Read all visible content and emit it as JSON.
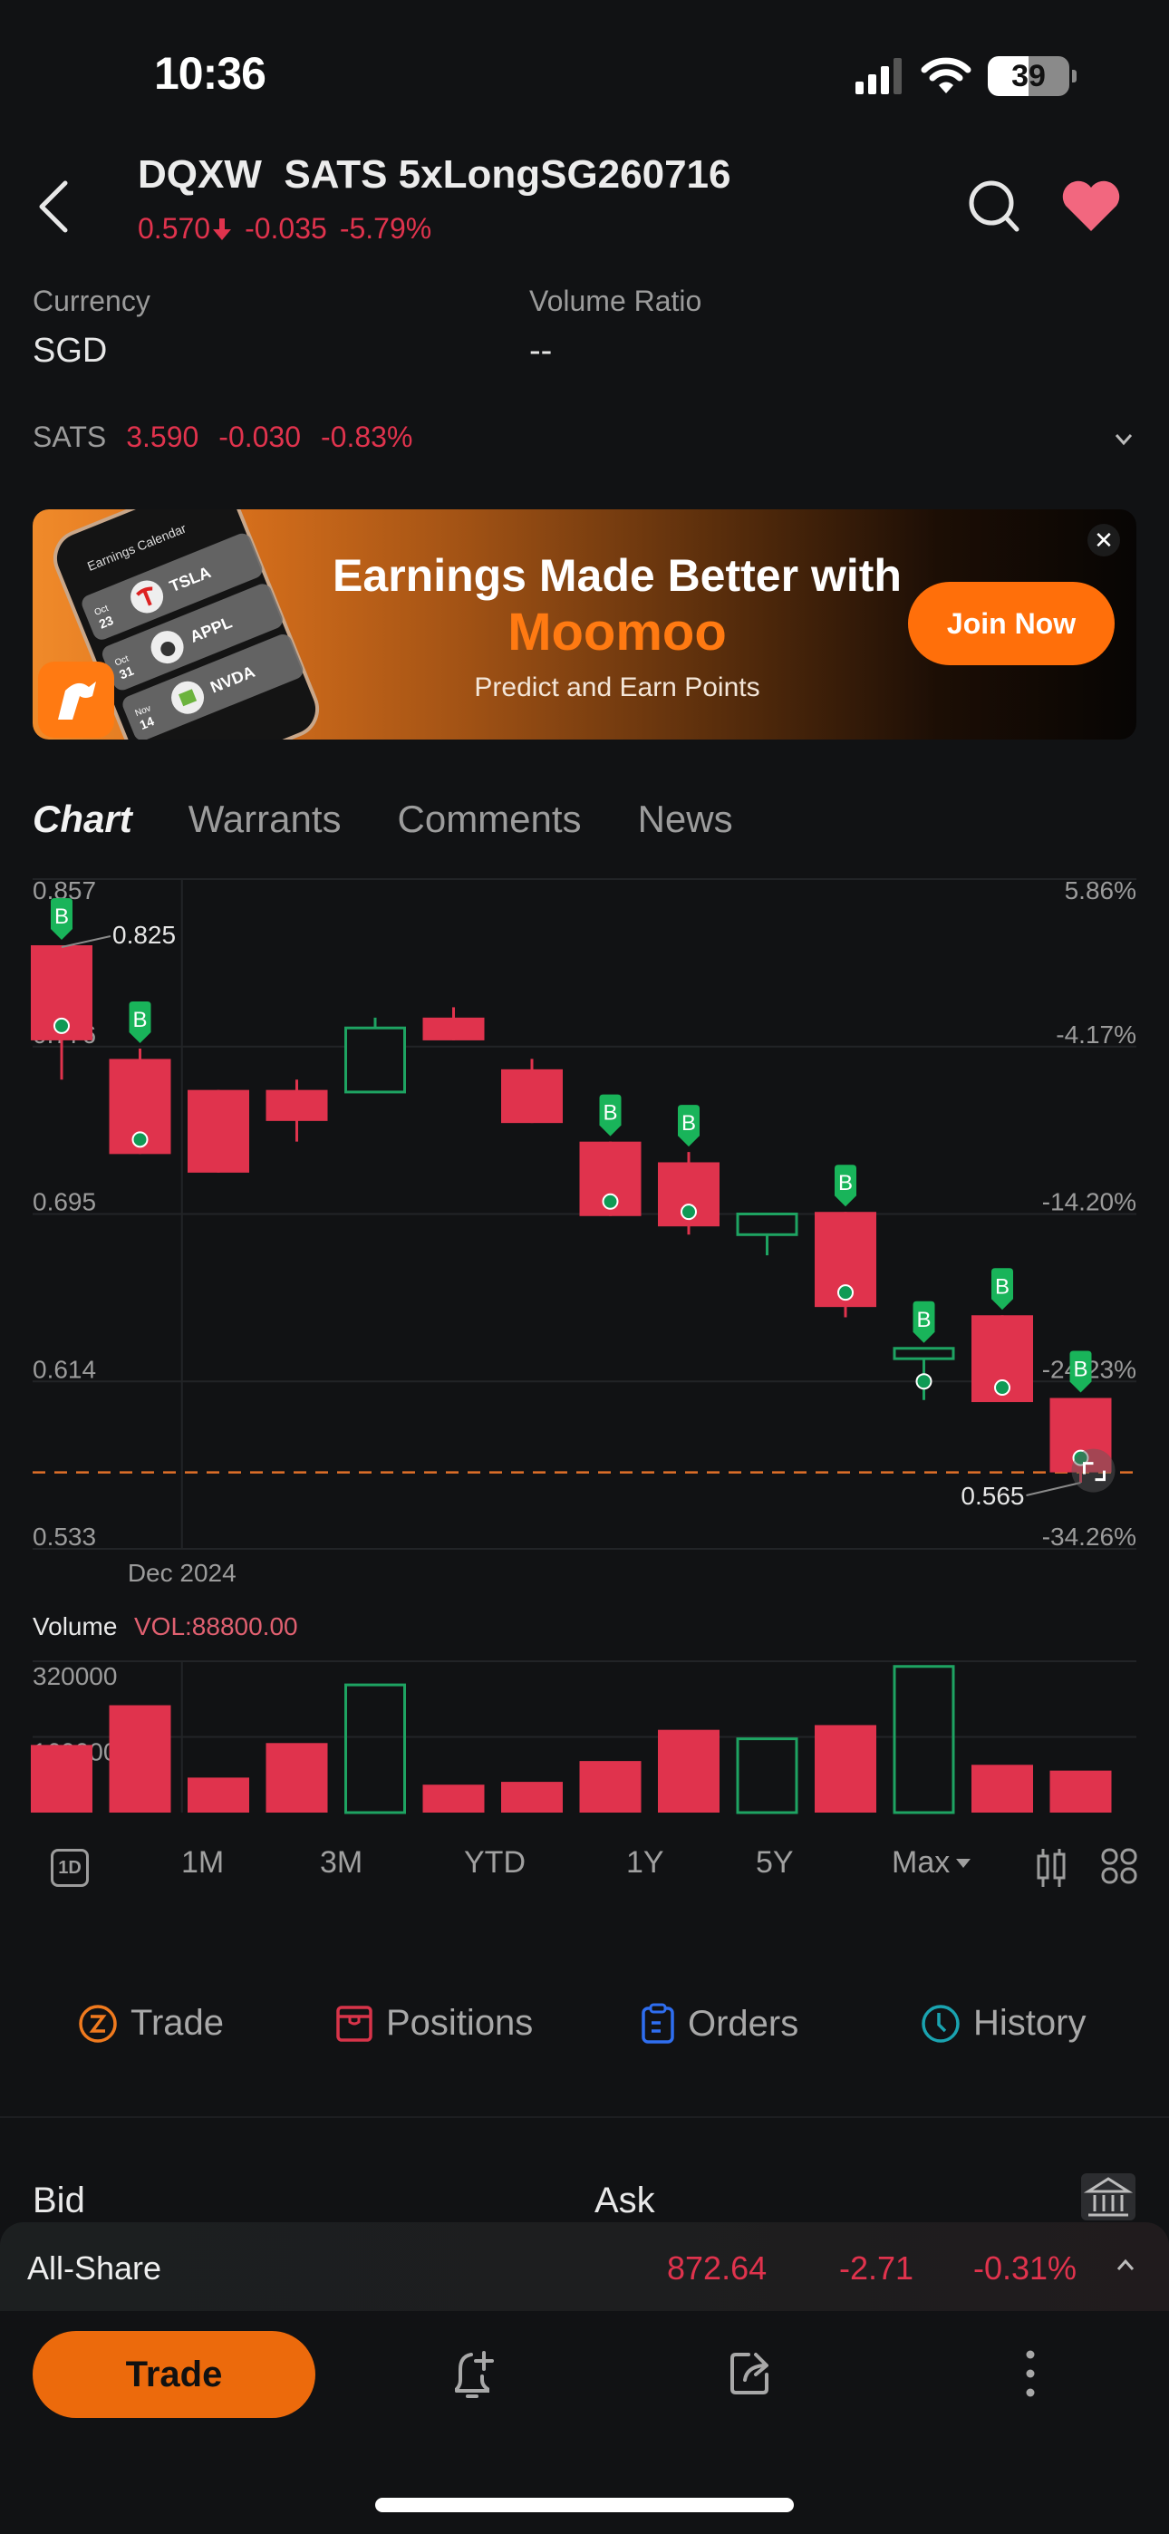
{
  "status_bar": {
    "time": "10:36",
    "battery": "39"
  },
  "header": {
    "code": "DQXW",
    "name": "SATS 5xLongSG260716",
    "price": "0.570",
    "change": "-0.035",
    "change_pct": "-5.79%"
  },
  "info": {
    "currency_label": "Currency",
    "currency_value": "SGD",
    "volume_ratio_label": "Volume Ratio",
    "volume_ratio_value": "--"
  },
  "underlying": {
    "name": "SATS",
    "price": "3.590",
    "change": "-0.030",
    "change_pct": "-0.83%"
  },
  "banner": {
    "line1": "Earnings Made Better with",
    "line2": "Moomoo",
    "line3": "Predict and Earn Points",
    "cta": "Join Now",
    "close": "✕",
    "art": {
      "title": "Earnings Calendar",
      "cards": [
        {
          "month": "Oct",
          "day": "23",
          "ticker": "TSLA"
        },
        {
          "month": "Oct",
          "day": "31",
          "ticker": "APPL"
        },
        {
          "month": "Nov",
          "day": "14",
          "ticker": "NVDA"
        }
      ]
    }
  },
  "tabs": [
    {
      "label": "Chart",
      "active": true
    },
    {
      "label": "Warrants",
      "active": false
    },
    {
      "label": "Comments",
      "active": false
    },
    {
      "label": "News",
      "active": false
    }
  ],
  "colors": {
    "down": "#e0334d",
    "up": "#1ea362",
    "accent": "#ec6a0c",
    "marker": "#19b45a"
  },
  "chart_data": {
    "type": "candlestick",
    "y_ticks": [
      "0.857",
      "0.776",
      "0.695",
      "0.614",
      "0.533"
    ],
    "y_tick_values": [
      0.857,
      0.776,
      0.695,
      0.614,
      0.533
    ],
    "pct_ticks": [
      "5.86%",
      "-4.17%",
      "-14.20%",
      "-24.23%",
      "-34.26%"
    ],
    "ylim": [
      0.533,
      0.857
    ],
    "x_label": "Dec 2024",
    "x_label_index": 2,
    "current_price": 0.57,
    "high_annotation": {
      "index": 0,
      "label": "0.825"
    },
    "low_annotation": {
      "index": 13,
      "label": "0.565"
    },
    "candles": [
      {
        "o": 0.825,
        "h": 0.825,
        "l": 0.76,
        "c": 0.779,
        "buy": true
      },
      {
        "o": 0.77,
        "h": 0.775,
        "l": 0.724,
        "c": 0.724,
        "buy": true
      },
      {
        "o": 0.755,
        "h": 0.755,
        "l": 0.715,
        "c": 0.715,
        "buy": false
      },
      {
        "o": 0.755,
        "h": 0.76,
        "l": 0.73,
        "c": 0.74,
        "buy": false
      },
      {
        "o": 0.754,
        "h": 0.79,
        "l": 0.754,
        "c": 0.785,
        "buy": false
      },
      {
        "o": 0.79,
        "h": 0.795,
        "l": 0.779,
        "c": 0.779,
        "buy": false
      },
      {
        "o": 0.765,
        "h": 0.77,
        "l": 0.739,
        "c": 0.739,
        "buy": false
      },
      {
        "o": 0.73,
        "h": 0.73,
        "l": 0.694,
        "c": 0.694,
        "buy": true
      },
      {
        "o": 0.72,
        "h": 0.725,
        "l": 0.685,
        "c": 0.689,
        "buy": true
      },
      {
        "o": 0.685,
        "h": 0.695,
        "l": 0.675,
        "c": 0.695,
        "buy": false
      },
      {
        "o": 0.696,
        "h": 0.696,
        "l": 0.645,
        "c": 0.65,
        "buy": true
      },
      {
        "o": 0.625,
        "h": 0.63,
        "l": 0.605,
        "c": 0.63,
        "buy": true
      },
      {
        "o": 0.646,
        "h": 0.646,
        "l": 0.604,
        "c": 0.604,
        "buy": true
      },
      {
        "o": 0.606,
        "h": 0.606,
        "l": 0.565,
        "c": 0.57,
        "buy": true
      }
    ],
    "buy_marker_label": "B",
    "volume": {
      "title": "Volume",
      "current_label": "VOL:88800.00",
      "y_ticks": [
        "320000",
        "160000"
      ],
      "y_tick_values": [
        320000,
        160000
      ],
      "ylim": [
        0,
        330000
      ],
      "values": [
        143000,
        227000,
        74000,
        147000,
        270000,
        59000,
        65000,
        109000,
        175000,
        156000,
        185000,
        309000,
        101000,
        88800
      ]
    }
  },
  "periods": [
    {
      "label": "1D",
      "boxed": true
    },
    {
      "label": "1M"
    },
    {
      "label": "3M"
    },
    {
      "label": "YTD"
    },
    {
      "label": "1Y"
    },
    {
      "label": "5Y"
    },
    {
      "label": "Max",
      "dropdown": true
    }
  ],
  "actions": [
    {
      "label": "Trade",
      "icon": "trade-icon",
      "color": "#f07a1e"
    },
    {
      "label": "Positions",
      "icon": "positions-icon",
      "color": "#d8344a"
    },
    {
      "label": "Orders",
      "icon": "orders-icon",
      "color": "#2f6ef0"
    },
    {
      "label": "History",
      "icon": "history-icon",
      "color": "#1aa3b0"
    }
  ],
  "order_book": {
    "bid_label": "Bid",
    "ask_label": "Ask"
  },
  "index_ticker": {
    "name": "All-Share",
    "value": "872.64",
    "change": "-2.71",
    "change_pct": "-0.31%"
  },
  "bottom_bar": {
    "trade_label": "Trade"
  }
}
